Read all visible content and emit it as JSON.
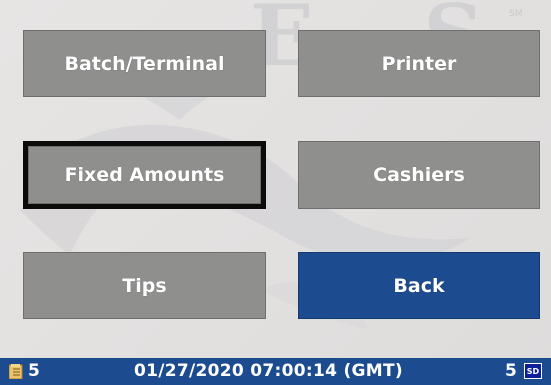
{
  "background": {
    "watermark_letters": "E S",
    "watermark_sm": "SM"
  },
  "buttons": {
    "batch_terminal": "Batch/Terminal",
    "printer": "Printer",
    "fixed_amounts": "Fixed Amounts",
    "cashiers": "Cashiers",
    "tips": "Tips",
    "back": "Back"
  },
  "selected_button": "fixed_amounts",
  "status_bar": {
    "left_count": "5",
    "datetime": "01/27/2020 07:00:14 (GMT)",
    "right_count": "5",
    "sd_label": "SD"
  },
  "colors": {
    "button_gray": "#8f908e",
    "accent_blue": "#1c4c8f",
    "selection_border": "#0b0b0b"
  },
  "icons": {
    "status_left": "folder-icon",
    "status_right": "sd-card-icon"
  }
}
